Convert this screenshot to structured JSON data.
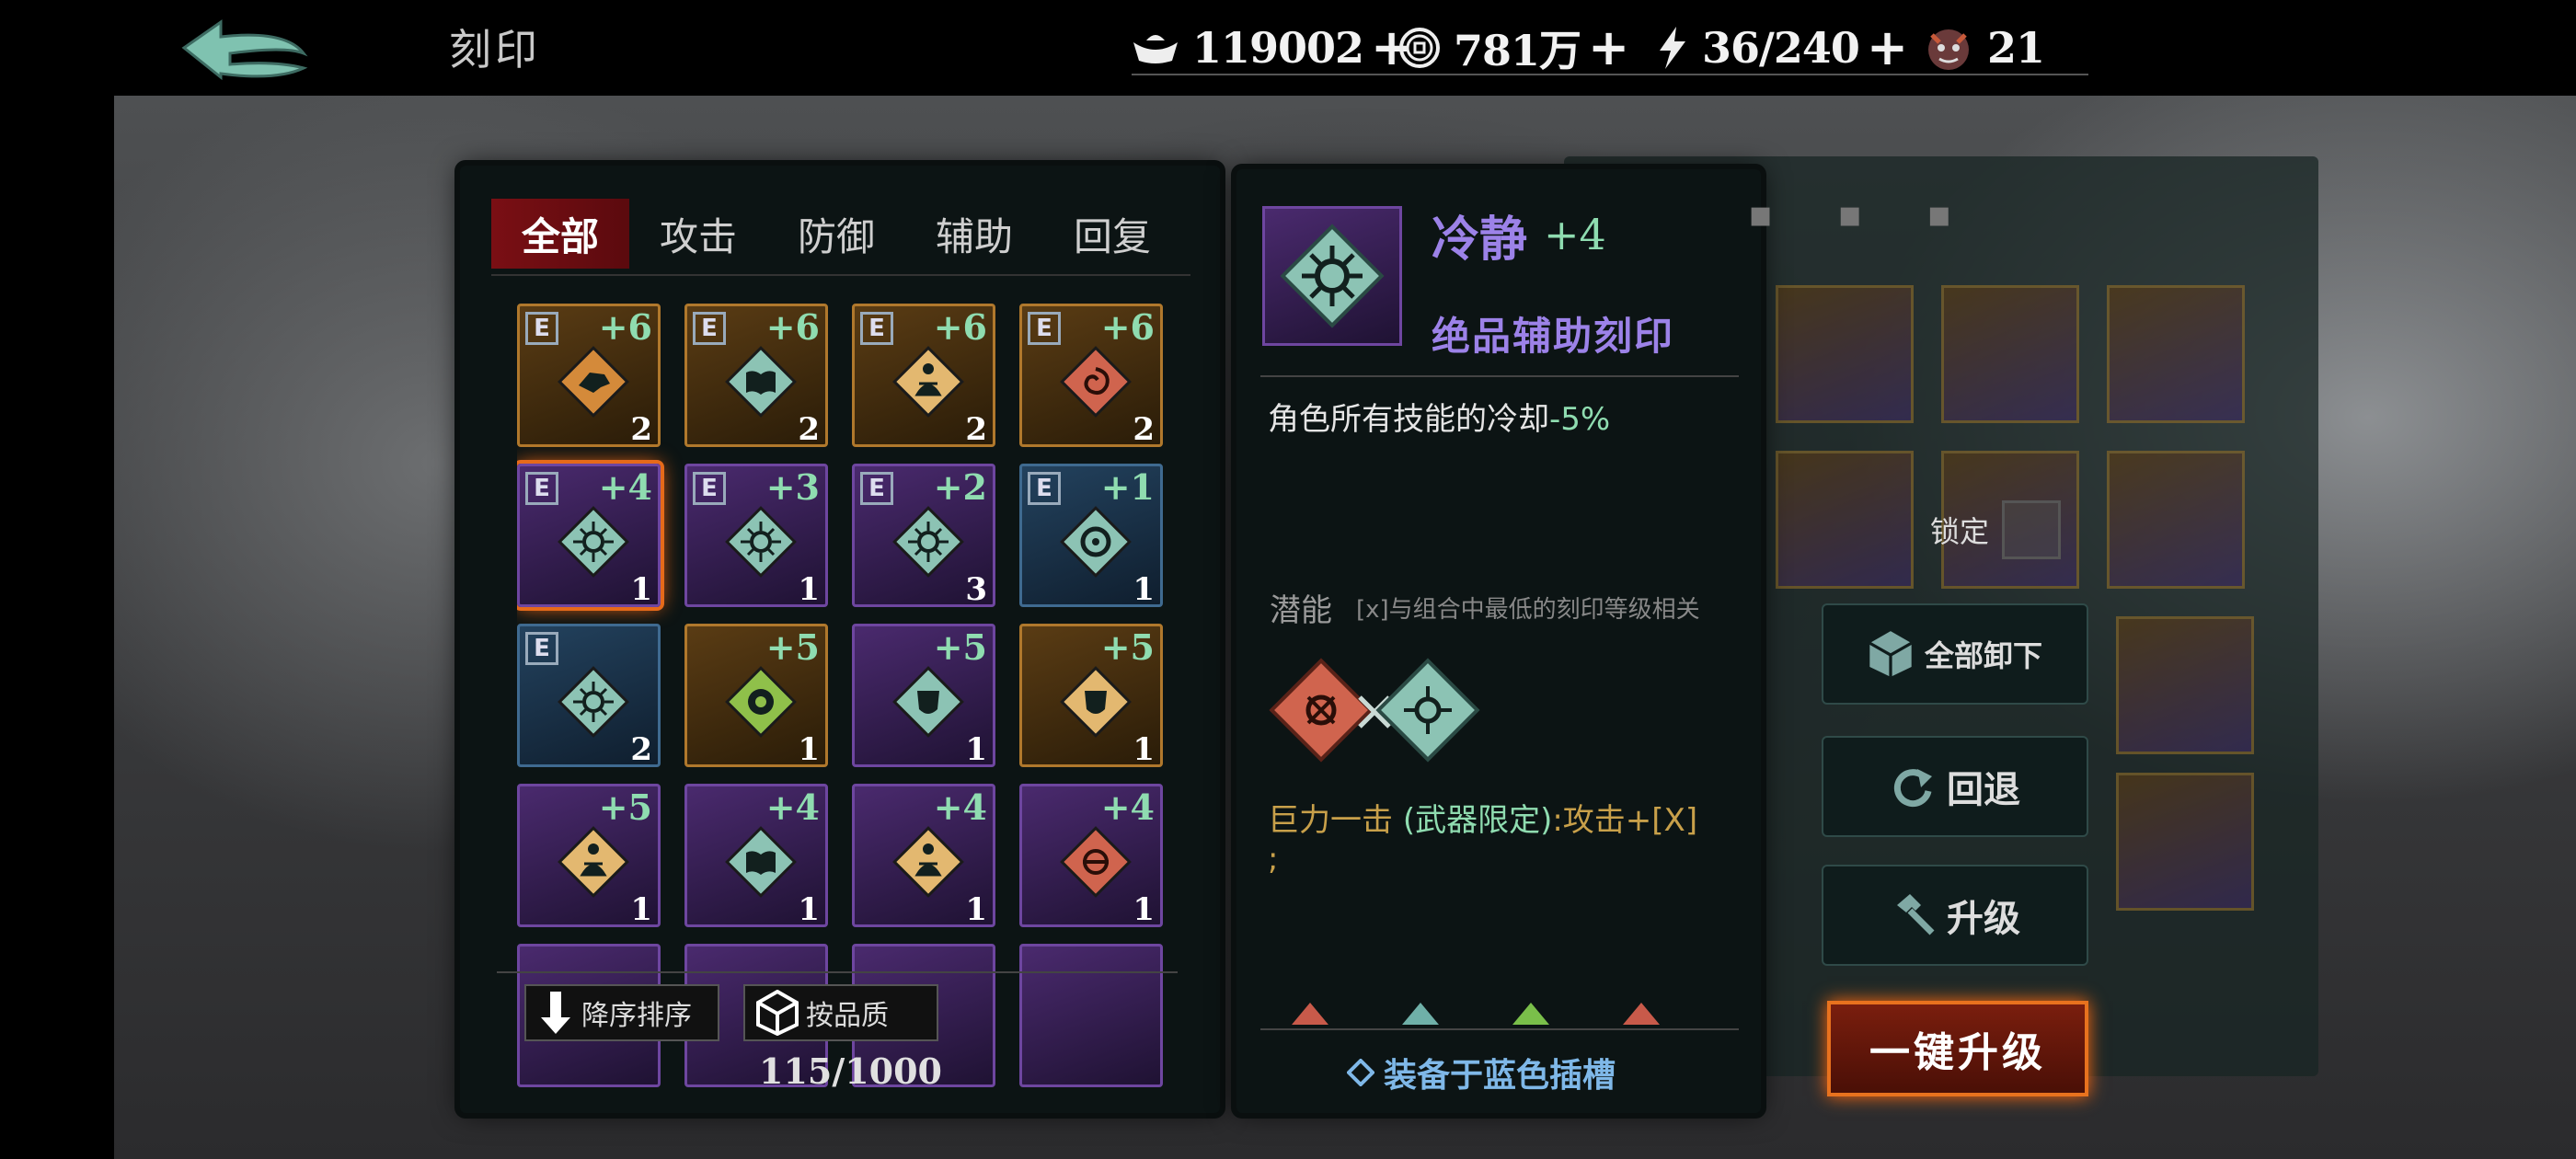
{
  "header": {
    "title": "刻印",
    "resources": [
      {
        "icon": "silver-ingot-icon",
        "value": "119002",
        "plus": "+"
      },
      {
        "icon": "coin-icon",
        "value": "781万",
        "plus": "+"
      },
      {
        "icon": "lightning-icon",
        "value": "36/240",
        "plus": "+"
      },
      {
        "icon": "demon-mask-icon",
        "value": "21",
        "plus": ""
      }
    ]
  },
  "inventory": {
    "tabs": [
      "全部",
      "攻击",
      "防御",
      "辅助",
      "回复"
    ],
    "active_tab": "全部",
    "items": [
      {
        "e": "E",
        "level": "+6",
        "count": "2",
        "rarity": "orange",
        "gem": "orange",
        "glyph": "beast"
      },
      {
        "e": "E",
        "level": "+6",
        "count": "2",
        "rarity": "orange",
        "gem": "teal",
        "glyph": "book"
      },
      {
        "e": "E",
        "level": "+6",
        "count": "2",
        "rarity": "orange",
        "gem": "gold",
        "glyph": "figure"
      },
      {
        "e": "E",
        "level": "+6",
        "count": "2",
        "rarity": "orange",
        "gem": "red",
        "glyph": "swirl"
      },
      {
        "e": "E",
        "level": "+4",
        "count": "1",
        "rarity": "purple",
        "gem": "teal",
        "glyph": "sun",
        "selected": true
      },
      {
        "e": "E",
        "level": "+3",
        "count": "1",
        "rarity": "purple",
        "gem": "teal",
        "glyph": "sun"
      },
      {
        "e": "E",
        "level": "+2",
        "count": "3",
        "rarity": "purple",
        "gem": "teal",
        "glyph": "sun"
      },
      {
        "e": "E",
        "level": "+1",
        "count": "1",
        "rarity": "blue",
        "gem": "teal",
        "glyph": "ring"
      },
      {
        "e": "E",
        "level": "",
        "count": "2",
        "rarity": "blue",
        "gem": "teal",
        "glyph": "sun"
      },
      {
        "e": "",
        "level": "+5",
        "count": "1",
        "rarity": "orange",
        "gem": "green",
        "glyph": "orb"
      },
      {
        "e": "",
        "level": "+5",
        "count": "1",
        "rarity": "purple",
        "gem": "teal",
        "glyph": "mask"
      },
      {
        "e": "",
        "level": "+5",
        "count": "1",
        "rarity": "orange",
        "gem": "gold",
        "glyph": "mask"
      },
      {
        "e": "",
        "level": "+5",
        "count": "1",
        "rarity": "purple",
        "gem": "gold",
        "glyph": "figure"
      },
      {
        "e": "",
        "level": "+4",
        "count": "1",
        "rarity": "purple",
        "gem": "teal",
        "glyph": "book"
      },
      {
        "e": "",
        "level": "+4",
        "count": "1",
        "rarity": "purple",
        "gem": "gold",
        "glyph": "figure"
      },
      {
        "e": "",
        "level": "+4",
        "count": "1",
        "rarity": "purple",
        "gem": "red",
        "glyph": "slash"
      }
    ],
    "sort_button": "降序排序",
    "quality_button": "按品质",
    "count_label": "115/1000"
  },
  "detail": {
    "name": "冷静",
    "level": "+4",
    "quality": "绝品辅助刻印",
    "desc_prefix": "角色所有技能的冷却",
    "desc_value": "-5%",
    "potential_label": "潜能",
    "potential_note": "[x]与组合中最低的刻印等级相关",
    "effect_prefix": "巨力一击",
    "effect_tag": "(武器限定)",
    "effect_suffix": ":攻击+[X]",
    "effect_end": ";",
    "equip_label": "装备于蓝色插槽"
  },
  "side": {
    "lock_label": "锁定",
    "unequip_all": "全部卸下",
    "rollback": "回退",
    "upgrade": "升级",
    "one_click_upgrade": "一键升级"
  },
  "colors": {
    "level_green": "#8fdcb0",
    "quality_purple": "#9c82e8",
    "tab_active": "#7a0f14",
    "effect_gold": "#c8a04a",
    "equip_blue": "#7fb8e8",
    "highlight_orange": "#e8721e"
  }
}
